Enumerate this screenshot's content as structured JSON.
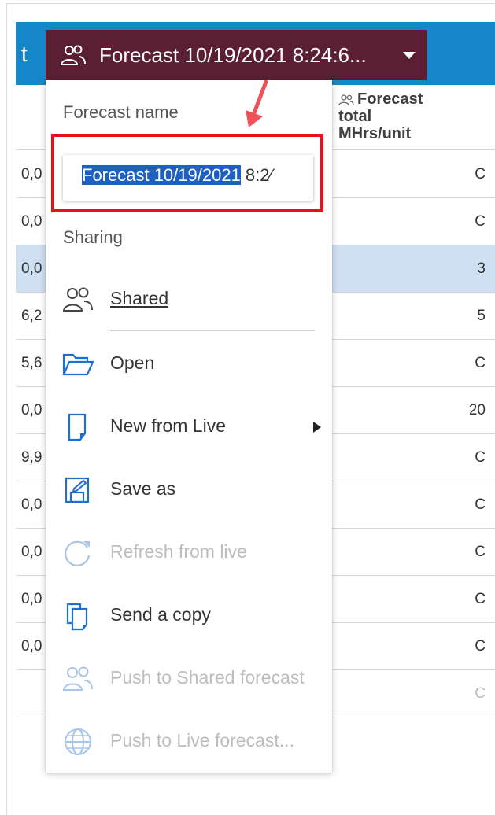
{
  "header": {
    "title_fragment": "t",
    "forecast_button_label": "Forecast 10/19/2021 8:24:6..."
  },
  "table": {
    "column_header": [
      "Forecast",
      "total",
      "MHrs/unit"
    ],
    "rows": [
      {
        "left": "0,0",
        "right": "C"
      },
      {
        "left": "0,0",
        "right": "C"
      },
      {
        "left": "0,0",
        "right": "3",
        "selected": true
      },
      {
        "left": "6,2",
        "right": "5"
      },
      {
        "left": "5,6",
        "right": "C"
      },
      {
        "left": "0,0",
        "right": "20"
      },
      {
        "left": "9,9",
        "right": "C"
      },
      {
        "left": "0,0",
        "right": "C"
      },
      {
        "left": "0,0",
        "right": "C"
      },
      {
        "left": "0,0",
        "right": "C"
      },
      {
        "left": "0,0",
        "right": "C"
      },
      {
        "left": "",
        "right": "C",
        "faded": true
      }
    ]
  },
  "menu": {
    "forecast_name_label": "Forecast name",
    "forecast_name_value_selected": "Forecast 10/19/2021",
    "forecast_name_value_rest": " 8:2⁄",
    "sharing_label": "Sharing",
    "items": [
      {
        "label": "Shared",
        "icon": "users-icon",
        "enabled": true
      },
      {
        "label": "Open",
        "icon": "folder-open-icon",
        "enabled": true
      },
      {
        "label": "New from Live",
        "icon": "new-document-icon",
        "enabled": true,
        "submenu": true
      },
      {
        "label": "Save as",
        "icon": "save-as-icon",
        "enabled": true
      },
      {
        "label": "Refresh from live",
        "icon": "refresh-icon",
        "enabled": false
      },
      {
        "label": "Send a copy",
        "icon": "copy-icon",
        "enabled": true
      },
      {
        "label": "Push to Shared forecast",
        "icon": "users-icon",
        "enabled": false
      },
      {
        "label": "Push to Live forecast...",
        "icon": "globe-icon",
        "enabled": false
      }
    ]
  },
  "colors": {
    "topbar": "#1587c9",
    "forecast_button": "#5a1f33",
    "highlight": "#e8101a",
    "selected_row": "#cfe0f3",
    "icon_blue": "#1f6fd1",
    "disabled": "#bdbdbd"
  }
}
